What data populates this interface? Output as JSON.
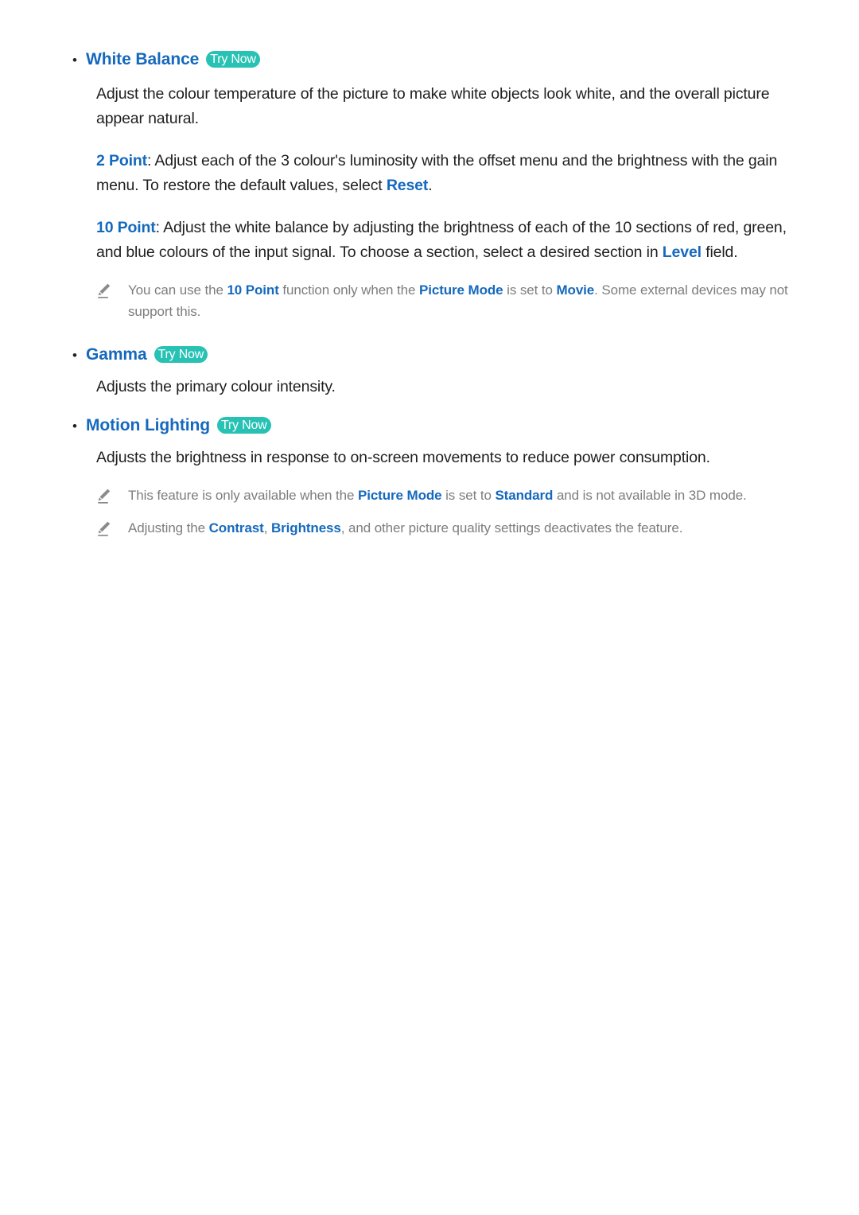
{
  "document": {
    "sections": [
      {
        "id": "white-balance",
        "bullet": "•",
        "title": "White Balance",
        "badge": "Try Now",
        "paragraphs": [
          {
            "id": "wb-intro",
            "runs": [
              {
                "text": "Adjust the colour temperature of the picture to make white objects look white, and the overall picture appear natural."
              }
            ]
          },
          {
            "id": "wb-2point",
            "runs": [
              {
                "text": "2 Point",
                "style": "keyword"
              },
              {
                "text": ": Adjust each of the 3 colour's luminosity with the offset menu and the brightness with the gain menu. To restore the default values, select "
              },
              {
                "text": "Reset",
                "style": "keyword"
              },
              {
                "text": "."
              }
            ]
          },
          {
            "id": "wb-10point",
            "runs": [
              {
                "text": "10 Point",
                "style": "keyword"
              },
              {
                "text": ": Adjust the white balance by adjusting the brightness of each of the 10 sections of red, green, and blue colours of the input signal. To choose a section, select a desired section in "
              },
              {
                "text": "Level",
                "style": "keyword"
              },
              {
                "text": " field."
              }
            ]
          }
        ],
        "notes": [
          {
            "id": "wb-note-1",
            "icon": "pencil-icon",
            "runs": [
              {
                "text": "You can use the "
              },
              {
                "text": "10 Point",
                "style": "keyword"
              },
              {
                "text": " function only when the "
              },
              {
                "text": "Picture Mode",
                "style": "keyword"
              },
              {
                "text": " is set to "
              },
              {
                "text": "Movie",
                "style": "keyword"
              },
              {
                "text": ". Some external devices may not support this."
              }
            ]
          }
        ]
      },
      {
        "id": "gamma",
        "bullet": "•",
        "title": "Gamma",
        "badge": "Try Now",
        "paragraphs": [
          {
            "id": "gamma-intro",
            "runs": [
              {
                "text": "Adjusts the primary colour intensity."
              }
            ]
          }
        ],
        "notes": []
      },
      {
        "id": "motion-lighting",
        "bullet": "•",
        "title": "Motion Lighting",
        "badge": "Try Now",
        "paragraphs": [
          {
            "id": "ml-intro",
            "runs": [
              {
                "text": "Adjusts the brightness in response to on-screen movements to reduce power consumption."
              }
            ]
          }
        ],
        "notes": [
          {
            "id": "ml-note-1",
            "icon": "pencil-icon",
            "runs": [
              {
                "text": "This feature is only available when the "
              },
              {
                "text": "Picture Mode",
                "style": "keyword"
              },
              {
                "text": " is set to "
              },
              {
                "text": "Standard",
                "style": "keyword"
              },
              {
                "text": " and is not available in 3D mode."
              }
            ]
          },
          {
            "id": "ml-note-2",
            "icon": "pencil-icon",
            "runs": [
              {
                "text": "Adjusting the "
              },
              {
                "text": "Contrast",
                "style": "keyword"
              },
              {
                "text": ", "
              },
              {
                "text": "Brightness",
                "style": "keyword"
              },
              {
                "text": ", and other picture quality settings deactivates the feature."
              }
            ]
          }
        ]
      }
    ]
  },
  "colors": {
    "heading_blue": "#1569bd",
    "keyword_blue": "#1569bd",
    "badge_teal": "#28c2b4",
    "badge_text": "#ffffff",
    "body_text": "#1f1f1f",
    "note_text": "#7d7d7d",
    "page_background": "#ffffff"
  }
}
